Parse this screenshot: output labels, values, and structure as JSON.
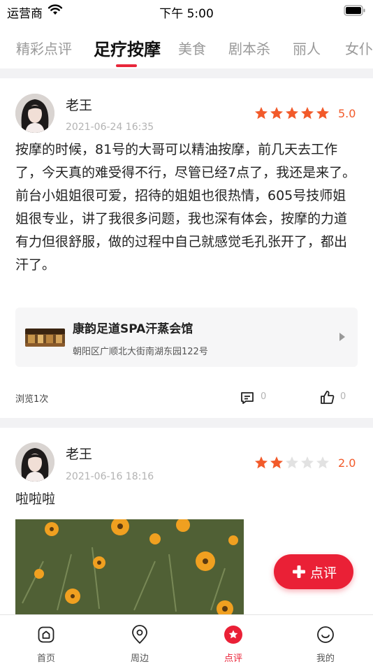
{
  "status_bar": {
    "carrier": "运营商",
    "time": "下午 5:00"
  },
  "tabs": [
    {
      "label": "精彩点评",
      "active": false
    },
    {
      "label": "足疗按摩",
      "active": true
    },
    {
      "label": "美食",
      "active": false
    },
    {
      "label": "剧本杀",
      "active": false
    },
    {
      "label": "丽人",
      "active": false
    },
    {
      "label": "女仆",
      "active": false
    }
  ],
  "reviews": [
    {
      "user": "老王",
      "date": "2021-06-24 16:35",
      "rating": 5,
      "rating_text": "5.0",
      "text": "按摩的时候，81号的大哥可以精油按摩，前几天去工作了，今天真的难受得不行，尽管已经7点了，我还是来了。前台小姐姐很可爱，招待的姐姐也很热情，605号技师姐姐很专业，讲了我很多问题，我也深有体会，按摩的力道有力但很舒服，做的过程中自己就感觉毛孔张开了，都出汗了。",
      "shop": {
        "name": "康韵足道SPA汗蒸会馆",
        "address": "朝阳区广顺北大街南湖东园122号"
      },
      "views": "浏览1次",
      "comments": "0",
      "likes": "0"
    },
    {
      "user": "老王",
      "date": "2021-06-16 18:16",
      "rating": 2,
      "rating_text": "2.0",
      "text": "啦啦啦"
    }
  ],
  "fab": {
    "label": "点评"
  },
  "bottom_nav": [
    {
      "label": "首页",
      "icon": "home-icon",
      "active": false
    },
    {
      "label": "周边",
      "icon": "location-pin-icon",
      "active": false
    },
    {
      "label": "点评",
      "icon": "review-star-icon",
      "active": true
    },
    {
      "label": "我的",
      "icon": "profile-smile-icon",
      "active": false
    }
  ],
  "colors": {
    "accent": "#ea2036",
    "star_filled": "#f25a2a",
    "star_empty": "#e2e2e2",
    "band": "#f2f2f4"
  }
}
